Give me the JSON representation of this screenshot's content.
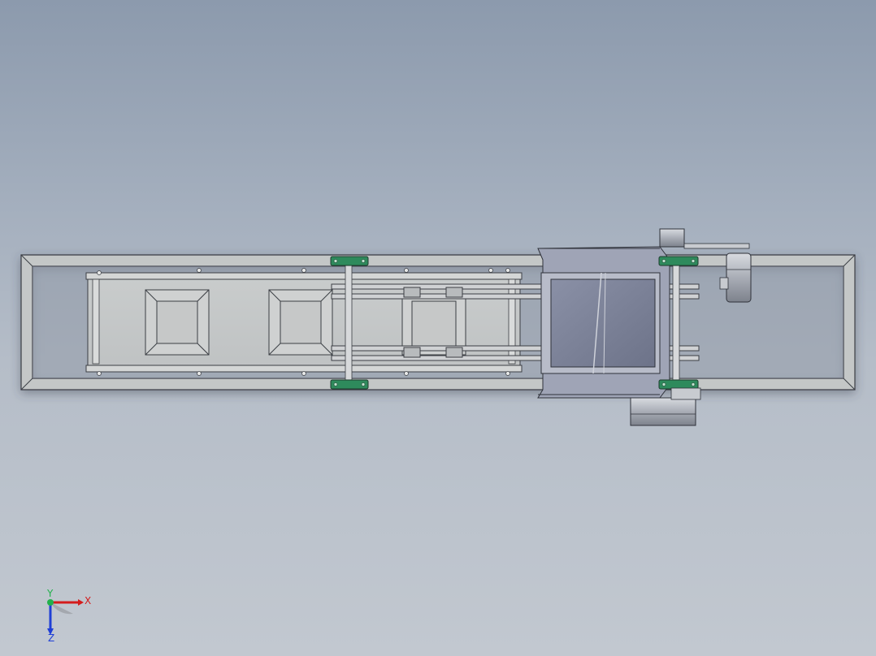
{
  "viewport": {
    "background_top": "#8c9aad",
    "background_bottom": "#c2c8d0"
  },
  "model": {
    "name": "belt-conveyor-assembly",
    "frame_color": "#c4c7c7",
    "bearing_color": "#2e8a5c",
    "motor_color": "#b9bcc4"
  },
  "triad": {
    "x_label": "X",
    "y_label": "Y",
    "z_label": "Z",
    "x_color": "#d41c1c",
    "y_color": "#22b14c",
    "z_color": "#1f3fd6"
  }
}
